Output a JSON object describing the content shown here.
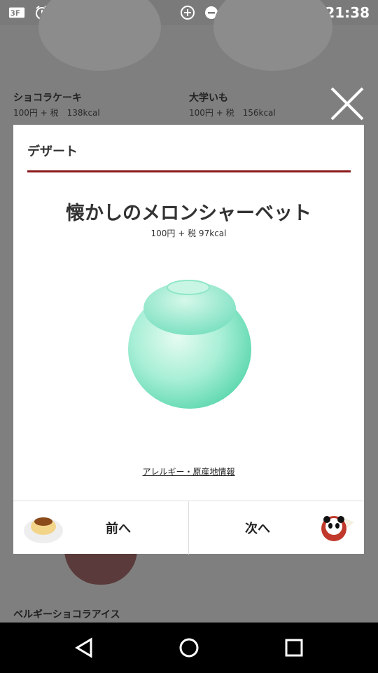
{
  "status_bar": {
    "time": "21:38",
    "left_icons": [
      "carrier-icon",
      "alarm-icon",
      "image-icon",
      "line-icon"
    ],
    "right_icons": [
      "data-saver-icon",
      "dnd-icon",
      "alarm-icon",
      "wifi-icon",
      "signal-icon",
      "battery-icon"
    ]
  },
  "background": {
    "items": [
      {
        "name": "ショコラケーキ",
        "price": "100円 + 税　138kcal"
      },
      {
        "name": "大学いも",
        "price": "100円 + 税　156kcal"
      },
      {
        "name": "ベルギーショコラアイス"
      }
    ]
  },
  "modal": {
    "category": "デザート",
    "product_name": "懐かしのメロンシャーベット",
    "price": "100円 + 税 97kcal",
    "allergy_link": "アレルギー・原産地情報",
    "prev_label": "前へ",
    "next_label": "次へ",
    "accent_color": "#8b1a1a",
    "product_color": "#7fe0c0"
  },
  "android_nav": {
    "buttons": [
      "back-icon",
      "home-icon",
      "recents-icon"
    ]
  }
}
